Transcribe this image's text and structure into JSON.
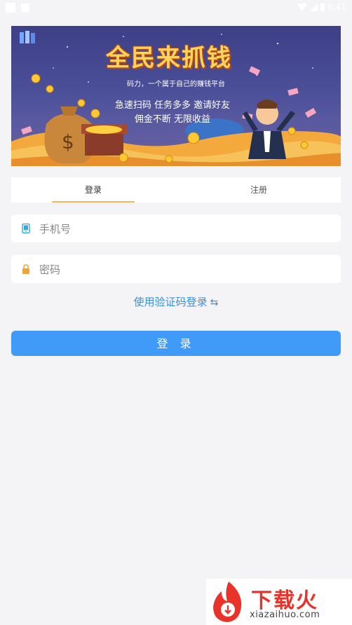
{
  "status_bar": {
    "time": "6:41"
  },
  "banner": {
    "title": "全民来抓钱",
    "subtitle": "码力，一个属于自己的赚钱平台",
    "line1": "急速扫码  任务多多  邀请好友",
    "line2": "佣金不断  无限收益"
  },
  "tabs": [
    {
      "label": "登录",
      "active": true
    },
    {
      "label": "注册",
      "active": false
    }
  ],
  "form": {
    "phone_placeholder": "手机号",
    "password_placeholder": "密码",
    "phone_value": "",
    "password_value": ""
  },
  "switch_link": {
    "label": "使用验证码登录",
    "icon": "swap-icon"
  },
  "login_button": {
    "label": "登 录"
  },
  "watermark": {
    "text": "下载火",
    "url": "xiazaihuo.com"
  },
  "colors": {
    "accent": "#3f9bf7",
    "link": "#3b8fde",
    "tab_underline": "#f5b85a",
    "banner_title": "#ffd45e",
    "watermark": "#e8322a"
  }
}
